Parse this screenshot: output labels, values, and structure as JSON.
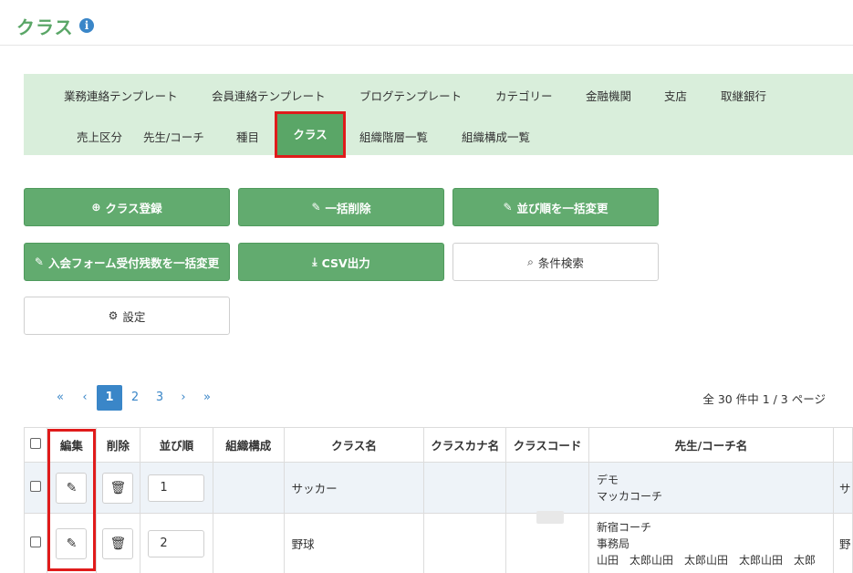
{
  "header": {
    "title": "クラス"
  },
  "nav": {
    "row1": [
      "業務連絡テンプレート",
      "会員連絡テンプレート",
      "ブログテンプレート",
      "カテゴリー",
      "金融機関",
      "支店",
      "取継銀行"
    ],
    "row2": [
      "売上区分",
      "先生/コーチ",
      "種目",
      "クラス",
      "組織階層一覧",
      "組織構成一覧"
    ],
    "active": "クラス"
  },
  "actions": {
    "register": "クラス登録",
    "bulk_delete": "一括削除",
    "bulk_order": "並び順を一括変更",
    "bulk_remaining": "入会フォーム受付残数を一括変更",
    "csv": "CSV出力",
    "search": "条件検索",
    "settings": "設定"
  },
  "pager": {
    "first": "«",
    "prev": "‹",
    "pages": [
      "1",
      "2",
      "3"
    ],
    "current": "1",
    "next": "›",
    "last": "»",
    "summary": "全 30 件中 1 / 3 ページ"
  },
  "table": {
    "headers": [
      "編集",
      "削除",
      "並び順",
      "組織構成",
      "クラス名",
      "クラスカナ名",
      "クラスコード",
      "先生/コーチ名"
    ],
    "rows": [
      {
        "order": "1",
        "org": "",
        "name": "サッカー",
        "kana": "",
        "code": "",
        "coach": [
          "デモ",
          "マッカコーチ"
        ],
        "extra": "サ"
      },
      {
        "order": "2",
        "org": "",
        "name": "野球",
        "kana": "",
        "code": "",
        "coach": [
          "新宿コーチ",
          "事務局",
          "山田　太郎山田　太郎山田　太郎山田　太郎"
        ],
        "extra": "野"
      }
    ]
  },
  "colors": {
    "accent": "#5aa667",
    "highlight": "#e01b1b",
    "link": "#3a86c8"
  }
}
